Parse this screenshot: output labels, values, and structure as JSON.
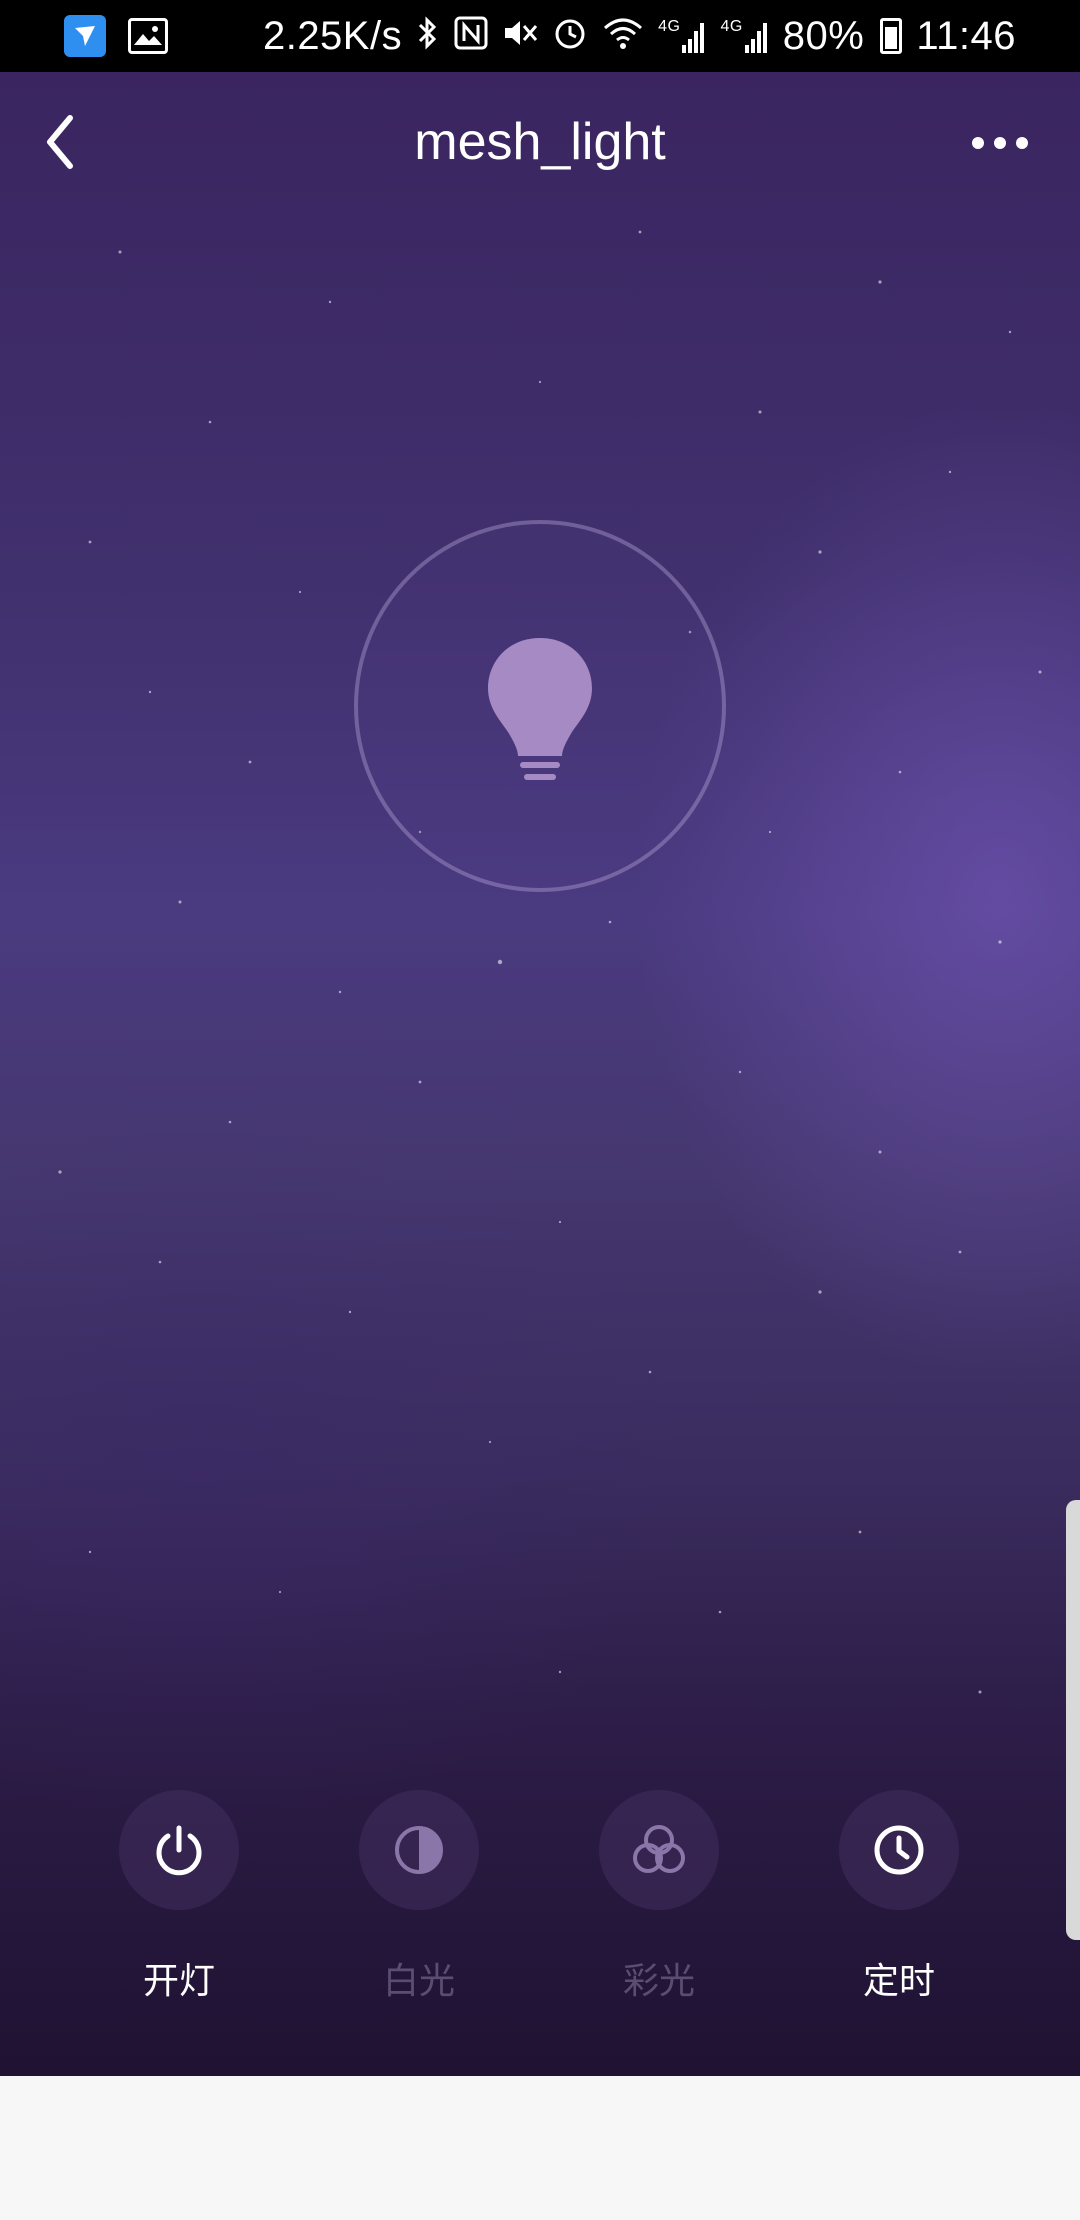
{
  "status_bar": {
    "net_speed": "2.25K/s",
    "signal_1": "4G",
    "signal_2": "4G",
    "battery": "80%",
    "time": "11:46",
    "icons": [
      "app-icon",
      "gallery-icon",
      "bluetooth-icon",
      "nfc-icon",
      "mute-icon",
      "alarm-icon",
      "wifi-icon",
      "signal-icon",
      "battery-icon"
    ]
  },
  "nav": {
    "title": "mesh_light",
    "back_icon": "chevron-left-icon",
    "more_icon": "more-dots-icon"
  },
  "bulb": {
    "icon": "lightbulb-icon",
    "state": "off"
  },
  "controls": [
    {
      "label": "开灯",
      "icon": "power-icon",
      "enabled": true
    },
    {
      "label": "白光",
      "icon": "half-circle-icon",
      "enabled": false
    },
    {
      "label": "彩光",
      "icon": "color-circles-icon",
      "enabled": false
    },
    {
      "label": "定时",
      "icon": "clock-icon",
      "enabled": true
    }
  ],
  "colors": {
    "accent": "#ffffff",
    "disabled": "#6b5a85",
    "background_top": "#3a2560",
    "background_bottom": "#1f1232"
  }
}
